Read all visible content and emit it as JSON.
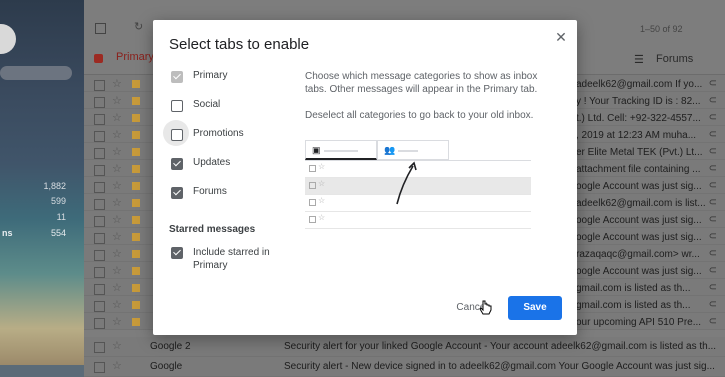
{
  "background": {
    "left_counts": [
      "1,882",
      "599",
      "11"
    ],
    "left_label": {
      "label": "ns",
      "count": "554"
    },
    "pager": "1–50 of 92",
    "tabs": {
      "primary": "Primary",
      "forums": "Forums"
    },
    "rows": [
      {
        "text": "adeelk62@gmail.com If yo..."
      },
      {
        "text": "y ! Your Tracking ID is : 82..."
      },
      {
        "text": "t.) Ltd. Cell: +92-322-4557..."
      },
      {
        "text": ", 2019 at 12:23 AM muha..."
      },
      {
        "text": "er Elite Metal TEK (Pvt.) Lt..."
      },
      {
        "text": "attachment file containing ..."
      },
      {
        "text": "oogle Account was just sig..."
      },
      {
        "text": "adeelk62@gmail.com is list..."
      },
      {
        "text": "oogle Account was just sig..."
      },
      {
        "text": "oogle Account was just sig..."
      },
      {
        "text": "razaqaqc@gmail.com> wr..."
      },
      {
        "text": "oogle Account was just sig..."
      },
      {
        "text": "gmail.com is listed as th..."
      },
      {
        "text": "gmail.com is listed as th..."
      },
      {
        "text": "our upcoming API 510 Pre..."
      }
    ],
    "bottom_rows": [
      {
        "sender": "Google 2",
        "subject": "Security alert for your linked Google Account - Your account adeelk62@gmail.com is listed as th..."
      },
      {
        "sender": "Google",
        "subject": "Security alert - New device signed in to adeelk62@gmail.com Your Google Account was just sig..."
      }
    ]
  },
  "dialog": {
    "title": "Select tabs to enable",
    "options": [
      {
        "label": "Primary",
        "checked": true,
        "disabled": true
      },
      {
        "label": "Social",
        "checked": false
      },
      {
        "label": "Promotions",
        "checked": false
      },
      {
        "label": "Updates",
        "checked": true
      },
      {
        "label": "Forums",
        "checked": true
      }
    ],
    "starred_section": "Starred messages",
    "starred_option": {
      "label": "Include starred in Primary",
      "checked": true
    },
    "description": "Choose which message categories to show as inbox tabs. Other messages will appear in the Primary tab.",
    "description2": "Deselect all categories to go back to your old inbox.",
    "cancel_label": "Cancel",
    "save_label": "Save",
    "colors": {
      "save": "#1a73e8",
      "primary_tab": "#d93025"
    }
  }
}
